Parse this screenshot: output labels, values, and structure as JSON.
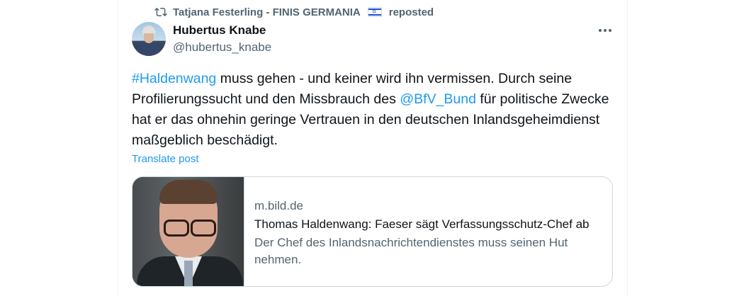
{
  "repost": {
    "icon": "repost-icon",
    "author": "Tatjana Festerling - FINIS GERMANIA",
    "flag": "israel-flag",
    "label": "reposted"
  },
  "author": {
    "display_name": "Hubertus Knabe",
    "handle": "@hubertus_knabe",
    "avatar": "avatar"
  },
  "post": {
    "hashtag": "#Haldenwang",
    "text_1": " muss gehen - und keiner wird ihn vermissen. Durch seine Profilierungssucht und den Missbrauch des ",
    "mention": "@BfV_Bund",
    "text_2": " für politische Zwecke hat er das ohnehin geringe Vertrauen in den deutschen Inlandsgeheimdienst maßgeblich beschädigt.",
    "translate_label": "Translate post"
  },
  "card": {
    "domain": "m.bild.de",
    "title": "Thomas Haldenwang: Faeser sägt Verfassungsschutz-Chef ab",
    "description": "Der Chef des Inlandsnachrichtendienstes muss seinen Hut nehmen."
  },
  "colors": {
    "link": "#1d9bf0",
    "secondary_text": "#536471",
    "primary_text": "#0f1419",
    "border": "#cfd9de"
  }
}
